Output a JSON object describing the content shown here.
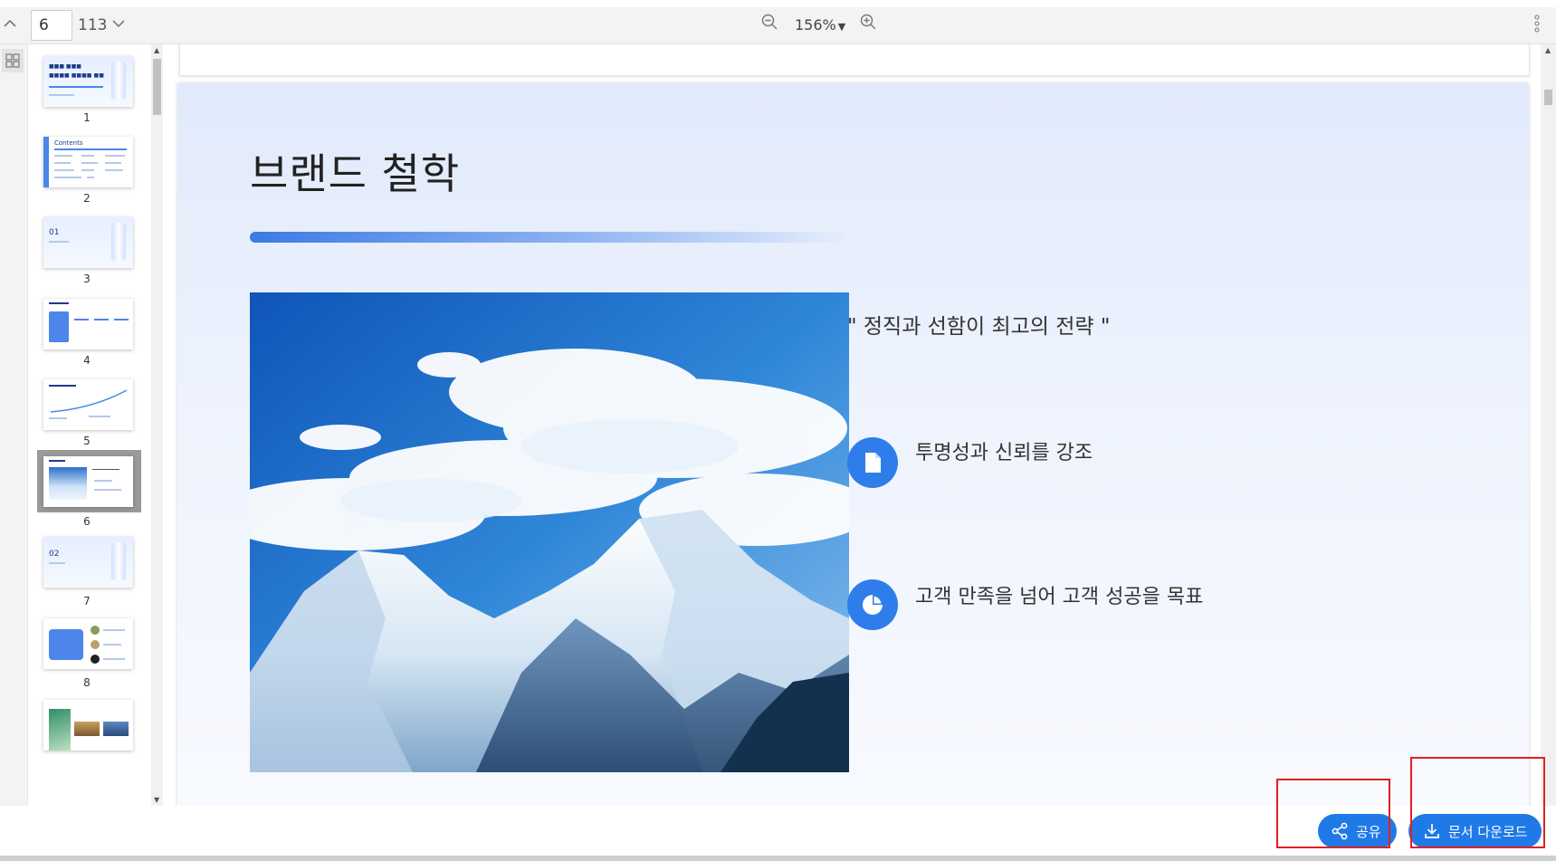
{
  "toolbar": {
    "current_page": "6",
    "total_pages": "113",
    "zoom": "156%",
    "zoom_caret": "▼",
    "icons": [
      "chevron-up-icon",
      "chevron-down-icon",
      "zoom-out-icon",
      "zoom-in-icon",
      "more-vertical-icon"
    ]
  },
  "sidebar": {
    "view_toggle_icon": "grid-view-icon",
    "thumbnails": [
      {
        "page": "1",
        "caption": "1"
      },
      {
        "page": "2",
        "caption": "2"
      },
      {
        "page": "3",
        "caption": "3"
      },
      {
        "page": "4",
        "caption": "4"
      },
      {
        "page": "5",
        "caption": "5"
      },
      {
        "page": "6",
        "caption": "6",
        "selected": true
      },
      {
        "page": "7",
        "caption": "7"
      },
      {
        "page": "8",
        "caption": "8"
      },
      {
        "page": "9",
        "caption": ""
      }
    ],
    "thumb_texts": {
      "t2": "Contents",
      "t3": "01",
      "t7": "02"
    }
  },
  "slide": {
    "title": "브랜드 철학",
    "quote": "\" 정직과 선함이 최고의 전략 \"",
    "points": [
      {
        "icon": "document-icon",
        "text": "투명성과 신뢰를 강조"
      },
      {
        "icon": "pie-chart-icon",
        "text": "고객 만족을 넘어 고객 성공을 목표"
      }
    ],
    "image": "snowy-mountain-photo"
  },
  "actions": {
    "share_label": "공유",
    "download_label": "문서 다운로드",
    "accent": "#1f7ae8",
    "highlight_color": "#e02020"
  }
}
